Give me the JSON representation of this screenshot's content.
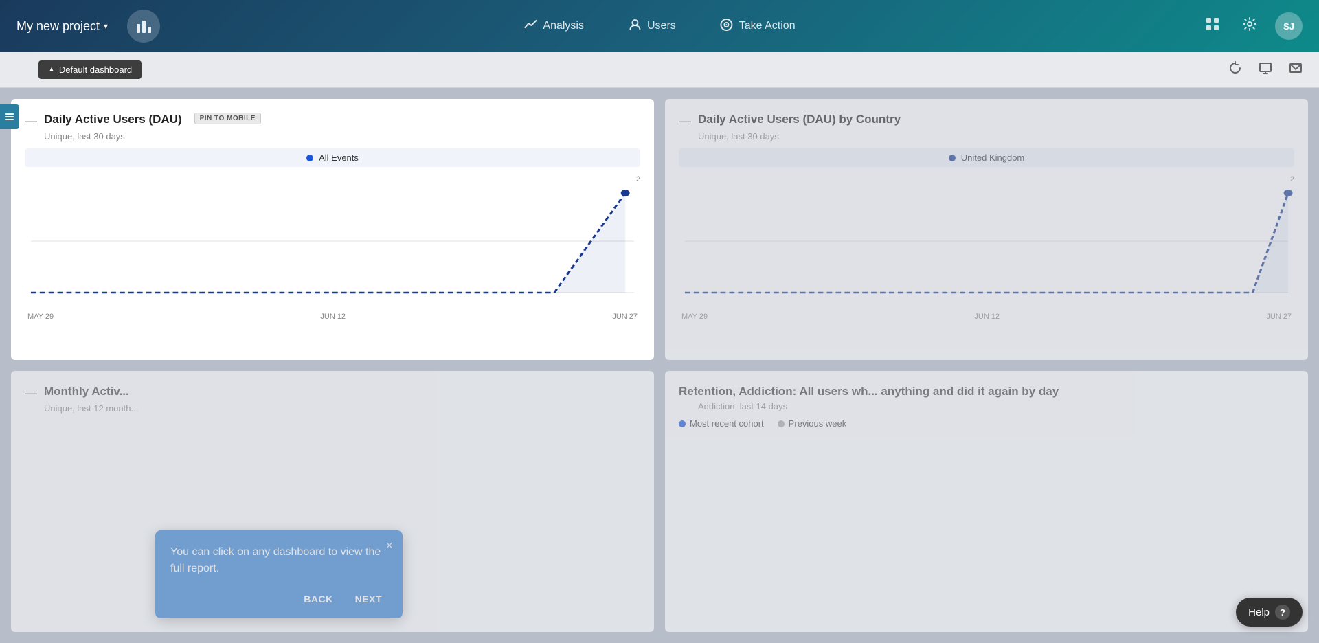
{
  "header": {
    "project_name": "My new project",
    "logo_icon": "📊",
    "nav": [
      {
        "id": "analysis",
        "label": "Analysis",
        "icon": "📈"
      },
      {
        "id": "users",
        "label": "Users",
        "icon": "👤"
      },
      {
        "id": "take-action",
        "label": "Take Action",
        "icon": "🎯"
      }
    ],
    "icons": {
      "grid": "⊞",
      "settings": "⚙",
      "avatar_initials": "SJ"
    }
  },
  "sub_header": {
    "dashboard_label": "Default dashboard",
    "dashboard_icon": "▲"
  },
  "charts": {
    "top_left": {
      "title": "Daily Active Users (DAU)",
      "dash": "—",
      "subtitle": "Unique, last 30 days",
      "pin_label": "PIN TO MOBILE",
      "legend_label": "All Events",
      "y_max": "2",
      "x_labels": [
        "MAY 29",
        "JUN 12",
        "JUN 27"
      ]
    },
    "top_right": {
      "title": "Daily Active Users (DAU) by Country",
      "dash": "—",
      "subtitle": "Unique, last 30 days",
      "legend_label": "United Kingdom",
      "y_max": "2",
      "x_labels": [
        "MAY 29",
        "JUN 12",
        "JUN 27"
      ]
    },
    "bottom_left": {
      "title": "Monthly Activ...",
      "dash": "—",
      "subtitle": "Unique, last 12 month..."
    },
    "bottom_right": {
      "title": "Retention, Addiction: All users wh... anything and did it again by day",
      "subtitle": "Addiction, last 14 days",
      "legend_label1": "Most recent cohort",
      "legend_label2": "Previous week"
    }
  },
  "tooltip": {
    "message": "You can click on any dashboard to view the full report.",
    "back_label": "BACK",
    "next_label": "NEXT",
    "close_icon": "×"
  },
  "help": {
    "label": "Help",
    "icon": "?"
  }
}
